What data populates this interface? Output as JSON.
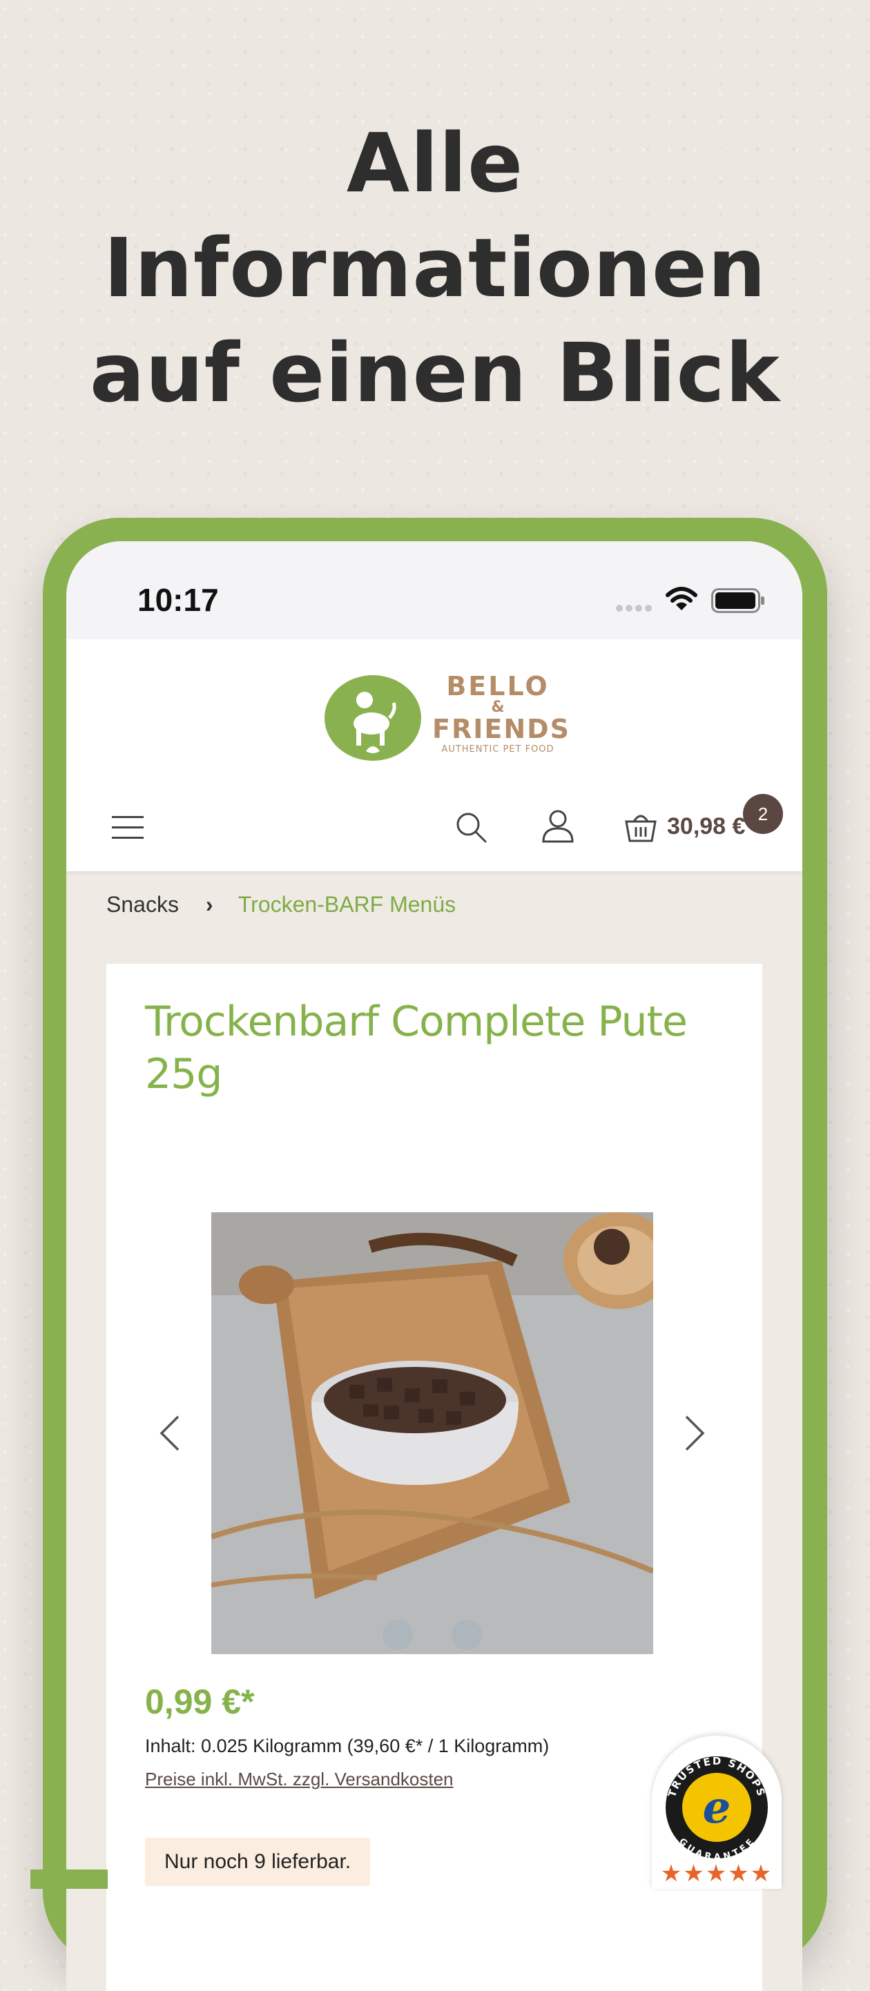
{
  "headline": {
    "line1": "Alle",
    "line2": "Informationen",
    "line3": "auf einen Blick"
  },
  "status_bar": {
    "time": "10:17"
  },
  "brand": {
    "name_line1": "BELLO",
    "name_amp": "&",
    "name_line2": "FRIENDS",
    "tagline": "AUTHENTIC PET FOOD",
    "primary_color": "#8ab14f",
    "secondary_color": "#b58c68"
  },
  "nav": {
    "cart_total": "30,98 €",
    "cart_count": "2"
  },
  "breadcrumb": {
    "items": [
      "Snacks",
      "Trocken-BARF Menüs"
    ]
  },
  "product": {
    "title": "Trockenbarf Complete Pute 25g",
    "price": "0,99 €*",
    "unit_info": "Inhalt: 0.025 Kilogramm (39,60 €* / 1 Kilogramm)",
    "tax_note": "Preise inkl. MwSt. zzgl. Versandkosten",
    "stock": "Nur noch 9 lieferbar."
  },
  "gallery": {
    "slide_count": 2,
    "active_slide": 1
  },
  "trusted_shops": {
    "top_text": "TRUSTED SHOPS",
    "bottom_text": "GUARANTEE",
    "letter": "e",
    "stars": "★★★★★"
  }
}
